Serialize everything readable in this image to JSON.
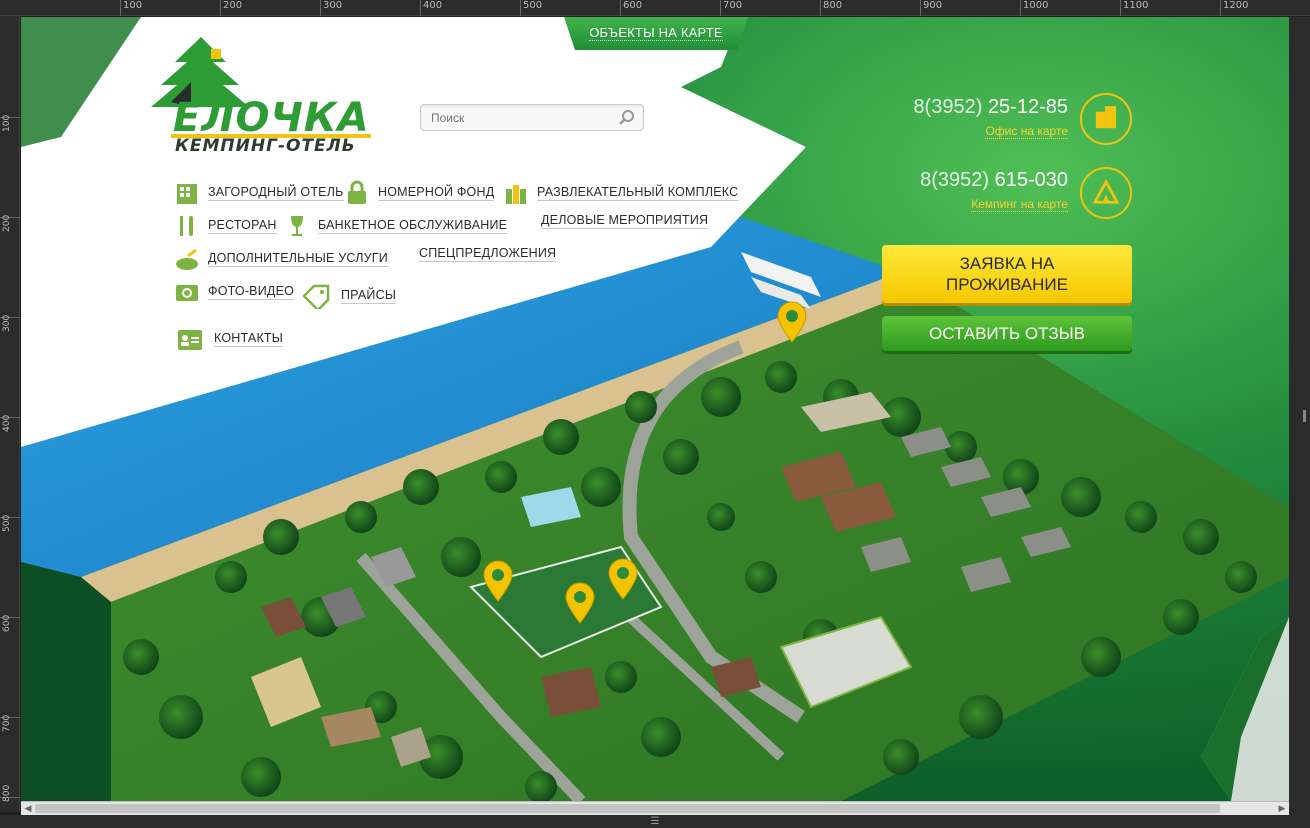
{
  "rulers": {
    "top": [
      "100",
      "200",
      "300",
      "400",
      "500",
      "600",
      "700",
      "800",
      "900",
      "1000",
      "1100",
      "1200"
    ],
    "left": [
      "100",
      "200",
      "300",
      "400",
      "500",
      "600",
      "700",
      "800"
    ]
  },
  "header": {
    "map_tab": "ОБЪЕКТЫ НА КАРТЕ",
    "logo_title": "ЕЛОЧКА",
    "logo_subtitle": "КЕМПИНГ-ОТЕЛЬ",
    "search_placeholder": "Поиск"
  },
  "menu": [
    {
      "label": "ЗАГОРОДНЫЙ ОТЕЛЬ",
      "icon": "hotel-icon"
    },
    {
      "label": "НОМЕРНОЙ ФОНД",
      "icon": "lock-icon"
    },
    {
      "label": "РАЗВЛЕКАТЕЛЬНЫЙ КОМПЛЕКС",
      "icon": "bottles-icon"
    },
    {
      "label": "РЕСТОРАН",
      "icon": "fork-knife-icon"
    },
    {
      "label": "БАНКЕТНОЕ ОБСЛУЖИВАНИЕ",
      "icon": "wine-glass-icon"
    },
    {
      "label": "ДЕЛОВЫЕ МЕРОПРИЯТИЯ",
      "icon": ""
    },
    {
      "label": "ДОПОЛНИТЕЛЬНЫЕ УСЛУГИ",
      "icon": "bath-icon"
    },
    {
      "label": "СПЕЦПРЕДЛОЖЕНИЯ",
      "icon": ""
    },
    {
      "label": "ФОТО-ВИДЕО",
      "icon": "camera-icon"
    },
    {
      "label": "ПРАЙСЫ",
      "icon": "price-tag-icon"
    },
    {
      "label": "КОНТАКТЫ",
      "icon": "contact-card-icon"
    }
  ],
  "contacts": {
    "phone1_prefix": "8(3952)",
    "phone1_number": "25-12-85",
    "phone1_link": "Офис на карте",
    "phone2_prefix": "8(3952)",
    "phone2_number": "615-030",
    "phone2_link": "Кемпинг на карте"
  },
  "buttons": {
    "booking_line1": "ЗАЯВКА НА",
    "booking_line2": "ПРОЖИВАНИЕ",
    "review": "ОСТАВИТЬ ОТЗЫВ"
  },
  "colors": {
    "brand_green": "#2d9c35",
    "accent_yellow": "#f6c800",
    "link_yellow": "#f7d432"
  }
}
